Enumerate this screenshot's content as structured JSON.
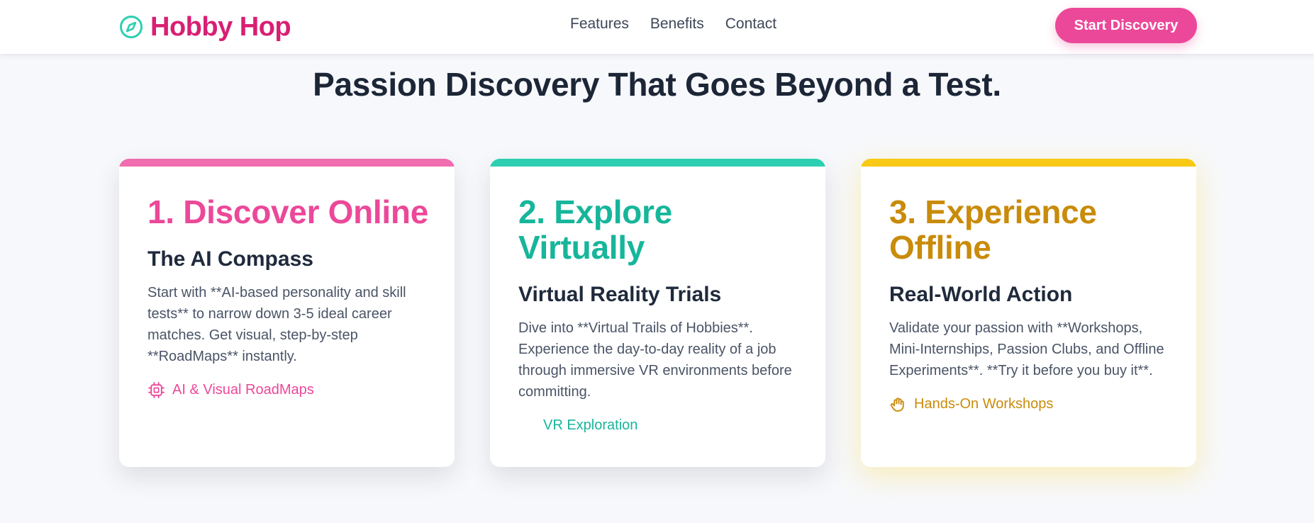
{
  "brand": {
    "name": "Hobby Hop",
    "icon": "compass-icon",
    "color": "#d81f73",
    "accent": "#2ccfb2"
  },
  "nav": {
    "links": [
      "Features",
      "Benefits",
      "Contact"
    ],
    "cta_label": "Start Discovery",
    "cta_color": "#ec4899"
  },
  "section": {
    "title": "Passion Discovery That Goes Beyond a Test."
  },
  "cards": [
    {
      "title": "1. Discover Online",
      "subtitle": "The AI Compass",
      "description": "Start with **AI-based personality and skill tests** to narrow down 3-5 ideal career matches. Get visual, step-by-step **RoadMaps** instantly.",
      "tag": "AI & Visual RoadMaps",
      "tag_icon": "cpu-chip-icon",
      "color": "#ec4899"
    },
    {
      "title": "2. Explore Virtually",
      "subtitle": "Virtual Reality Trials",
      "description": "Dive into **Virtual Trails of Hobbies**. Experience the day-to-day reality of a job through immersive VR environments before committing.",
      "tag": "VR Exploration",
      "tag_icon": "vr-icon",
      "color": "#17b69b"
    },
    {
      "title": "3. Experience Offline",
      "subtitle": "Real-World Action",
      "description": "Validate your passion with **Workshops, Mini-Internships, Passion Clubs, and Offline Experiments**. **Try it before you buy it**.",
      "tag": "Hands-On Workshops",
      "tag_icon": "hand-icon",
      "color": "#c98b0a"
    }
  ]
}
